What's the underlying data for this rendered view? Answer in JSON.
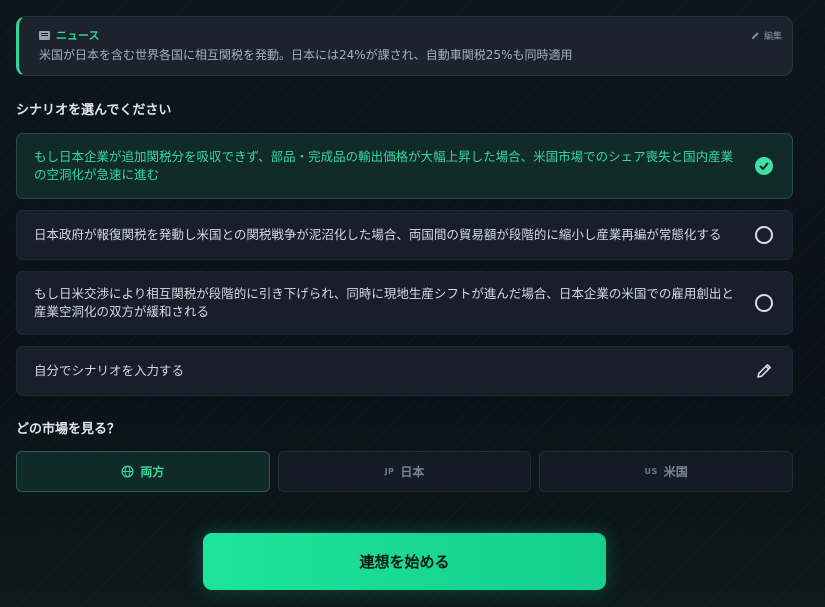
{
  "news": {
    "label": "ニュース",
    "icon": "newspaper-icon",
    "edit_label": "編集",
    "text": "米国が日本を含む世界各国に相互関税を発動。日本には24%が課され、自動車関税25%も同時適用"
  },
  "scenario_section": {
    "title": "シナリオを選んでください",
    "options": [
      {
        "label": "もし日本企業が追加関税分を吸収できず、部品・完成品の輸出価格が大幅上昇した場合、米国市場でのシェア喪失と国内産業の空洞化が急速に進む",
        "selected": true
      },
      {
        "label": "日本政府が報復関税を発動し米国との関税戦争が泥沼化した場合、両国間の貿易額が段階的に縮小し産業再編が常態化する",
        "selected": false
      },
      {
        "label": "もし日米交渉により相互関税が段階的に引き下げられ、同時に現地生産シフトが進んだ場合、日本企業の米国での雇用創出と産業空洞化の双方が緩和される",
        "selected": false
      }
    ],
    "custom_label": "自分でシナリオを入力する"
  },
  "market_section": {
    "title": "どの市場を見る？",
    "options": [
      {
        "code": "",
        "label": "両方",
        "icon": "globe-icon",
        "active": true
      },
      {
        "code": "JP",
        "label": "日本",
        "active": false
      },
      {
        "code": "US",
        "label": "米国",
        "active": false
      }
    ]
  },
  "start_button": {
    "label": "連想を始める"
  },
  "colors": {
    "accent": "#2fd79a",
    "button": "#1ee39b",
    "background": "#0b1219"
  }
}
